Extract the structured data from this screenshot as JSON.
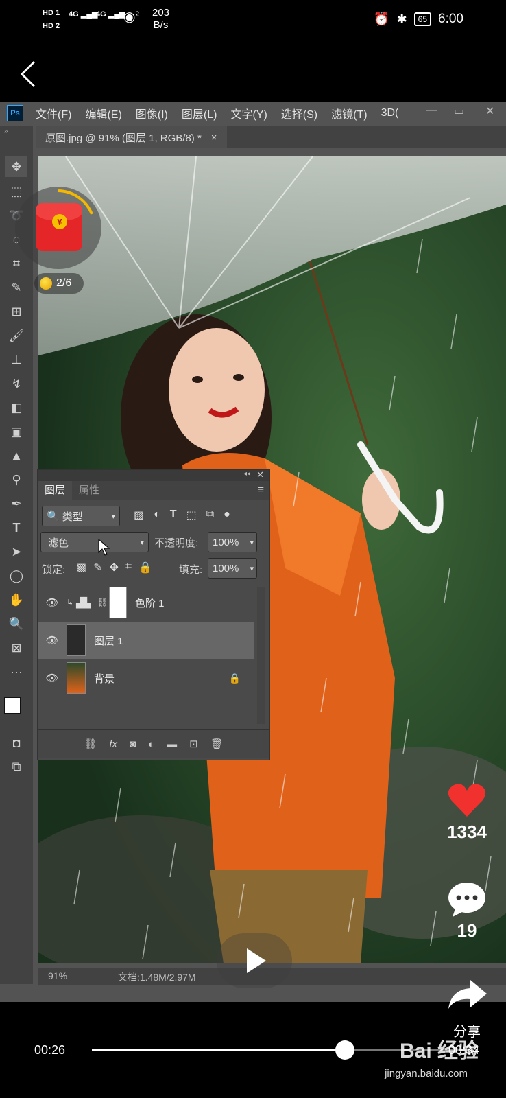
{
  "status_bar": {
    "network_labels": [
      "HD 1",
      "HD 2"
    ],
    "signal1": "4G",
    "signal2": "4G",
    "wifi_level": "2",
    "speed_value": "203",
    "speed_unit": "B/s",
    "battery": "65",
    "time": "6:00"
  },
  "photoshop": {
    "logo": "Ps",
    "menu": [
      "文件(F)",
      "编辑(E)",
      "图像(I)",
      "图层(L)",
      "文字(Y)",
      "选择(S)",
      "滤镜(T)",
      "3D("
    ],
    "document_tab": "原图.jpg @ 91% (图层 1, RGB/8) *",
    "tab_close": "×",
    "tools": [
      "move-tool-icon",
      "marquee-tool-icon",
      "lasso-tool-icon",
      "quick-select-tool-icon",
      "crop-tool-icon",
      "eyedropper-tool-icon",
      "heal-tool-icon",
      "brush-tool-icon",
      "stamp-tool-icon",
      "history-brush-tool-icon",
      "eraser-tool-icon",
      "gradient-tool-icon",
      "blur-tool-icon",
      "dodge-tool-icon",
      "pen-tool-icon",
      "type-tool-icon",
      "path-select-tool-icon",
      "ellipse-tool-icon",
      "hand-tool-icon",
      "zoom-tool-icon",
      "frame-tool-icon",
      "more-tools-icon"
    ],
    "layers_panel": {
      "tabs": [
        "图层",
        "属性"
      ],
      "filter_kind": "类型",
      "blend_mode": "滤色",
      "opacity_label": "不透明度:",
      "opacity_value": "100%",
      "lock_label": "锁定:",
      "fill_label": "填充:",
      "fill_value": "100%",
      "layers": [
        {
          "name": "色阶 1",
          "type": "adjustment",
          "visible": true,
          "selected": false
        },
        {
          "name": "图层 1",
          "type": "pixel",
          "visible": true,
          "selected": true
        },
        {
          "name": "背景",
          "type": "background",
          "visible": true,
          "selected": false,
          "locked": true
        }
      ],
      "footer_fx": "fx"
    },
    "zoom": "91%",
    "doc_size": "文档:1.48M/2.97M"
  },
  "overlay": {
    "red_packet_symbol": "¥",
    "counter": "2/6",
    "likes": "1334",
    "comments": "19",
    "share_label": "分享"
  },
  "player": {
    "current_time": "00:26",
    "total_time": "00:34",
    "progress": 0.67
  },
  "watermark": {
    "brand": "Bai 经验",
    "url": "jingyan.baidu.com"
  },
  "colors": {
    "accent_red": "#e52628",
    "ps_blue": "#31a8ff",
    "orange_jacket": "#e0621a"
  }
}
